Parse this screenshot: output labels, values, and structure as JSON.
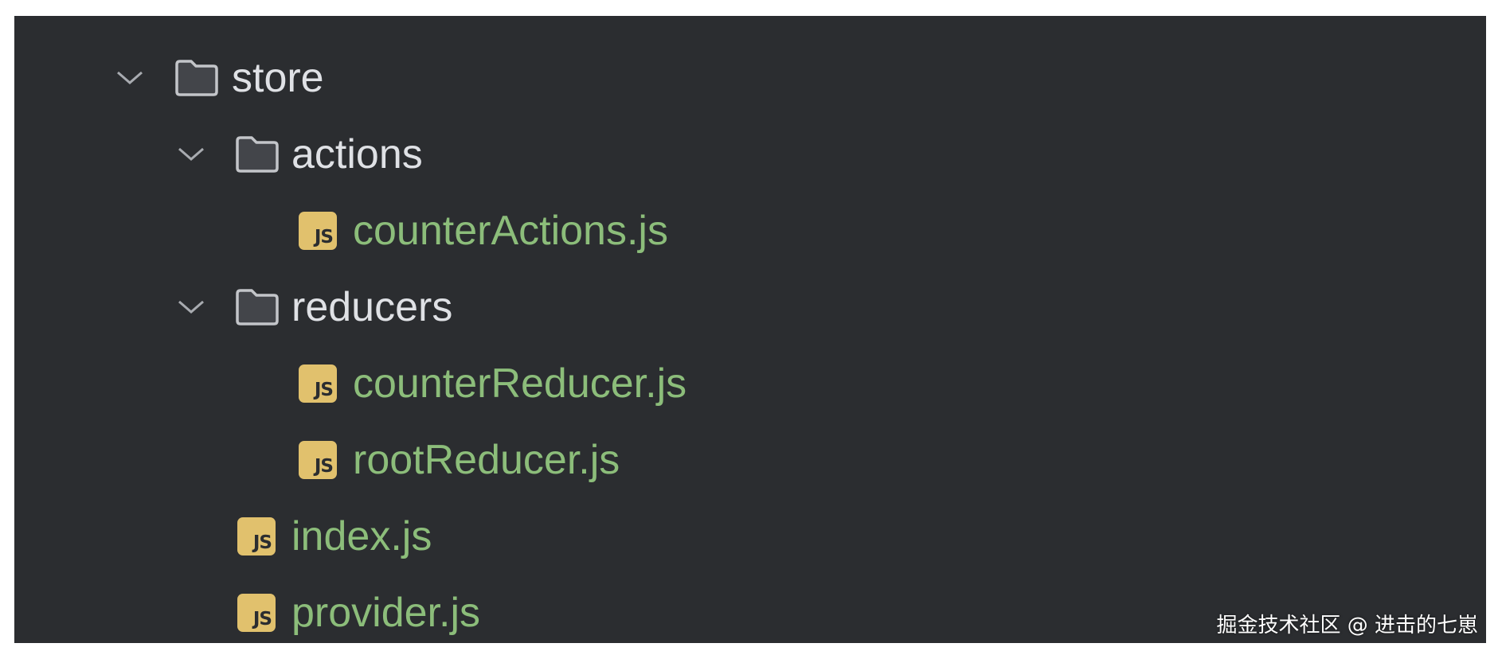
{
  "colors": {
    "panel_background": "#2b2d30",
    "folder_label": "#dfe1e5",
    "file_label": "#8cbd7a",
    "js_badge": "#e1c16d"
  },
  "tree": [
    {
      "label": "store",
      "kind": "folder",
      "expanded": true,
      "icon": "folder-icon"
    },
    {
      "label": "actions",
      "kind": "folder",
      "expanded": true,
      "icon": "folder-icon"
    },
    {
      "label": "counterActions.js",
      "kind": "file",
      "icon": "js-file-icon",
      "badge": "JS"
    },
    {
      "label": "reducers",
      "kind": "folder",
      "expanded": true,
      "icon": "folder-icon"
    },
    {
      "label": "counterReducer.js",
      "kind": "file",
      "icon": "js-file-icon",
      "badge": "JS"
    },
    {
      "label": "rootReducer.js",
      "kind": "file",
      "icon": "js-file-icon",
      "badge": "JS"
    },
    {
      "label": "index.js",
      "kind": "file",
      "icon": "js-file-icon",
      "badge": "JS"
    },
    {
      "label": "provider.js",
      "kind": "file",
      "icon": "js-file-icon",
      "badge": "JS"
    }
  ],
  "watermark": "掘金技术社区 @ 进击的七崽"
}
